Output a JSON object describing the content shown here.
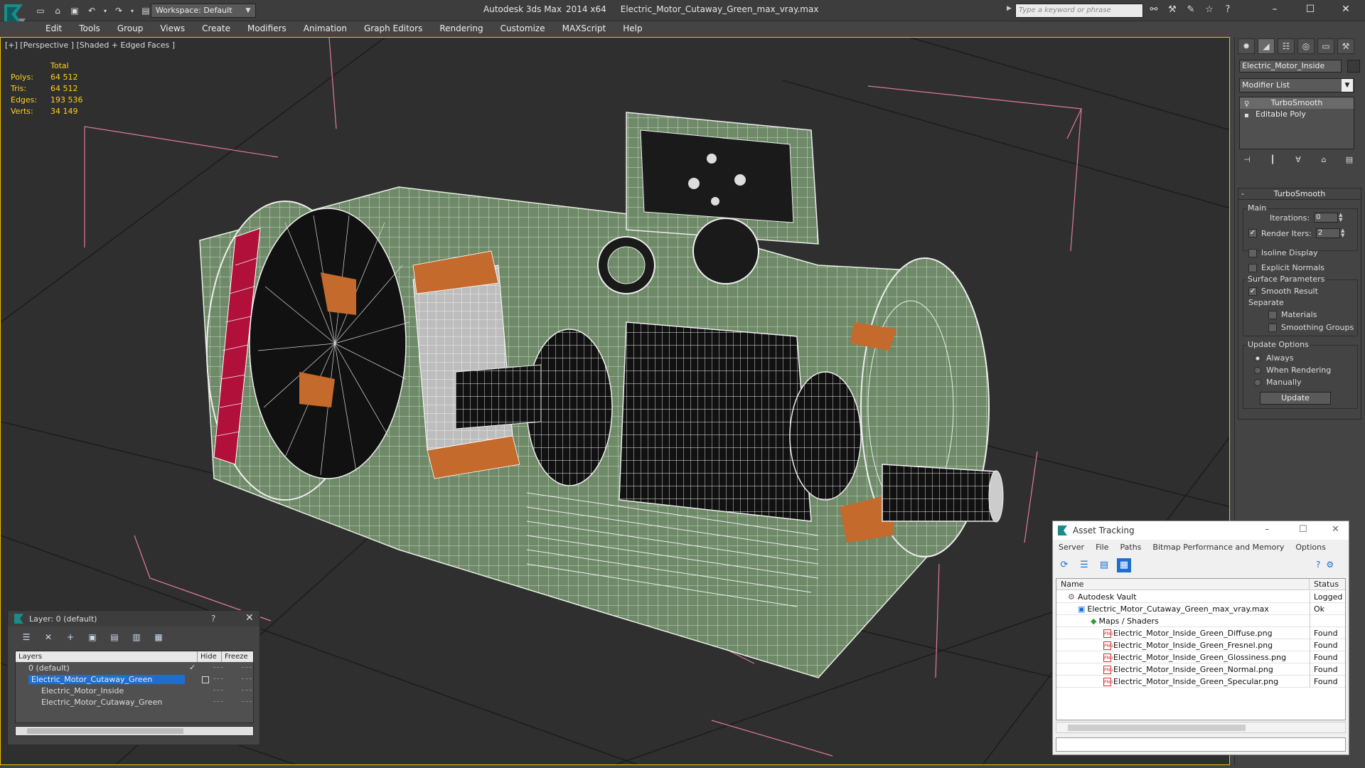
{
  "titlebar": {
    "app_name": "Autodesk 3ds Max",
    "version": "2014 x64",
    "file_name": "Electric_Motor_Cutaway_Green_max_vray.max",
    "workspace": "Workspace: Default",
    "search_placeholder": "Type a keyword or phrase",
    "minimize": "–",
    "maximize": "☐",
    "close": "✕"
  },
  "menu": [
    "Edit",
    "Tools",
    "Group",
    "Views",
    "Create",
    "Modifiers",
    "Animation",
    "Graph Editors",
    "Rendering",
    "Customize",
    "MAXScript",
    "Help"
  ],
  "viewport": {
    "label": "[+] [Perspective ] [Shaded + Edged Faces ]",
    "stats": {
      "header": "Total",
      "rows": [
        {
          "k": "Polys:",
          "v": "64 512"
        },
        {
          "k": "Tris:",
          "v": "64 512"
        },
        {
          "k": "Edges:",
          "v": "193 536"
        },
        {
          "k": "Verts:",
          "v": "34 149"
        }
      ]
    }
  },
  "command_panel": {
    "object_name": "Electric_Motor_Inside",
    "modifier_list": "Modifier List",
    "stack": [
      "TurboSmooth",
      "Editable Poly"
    ],
    "rollout_title": "TurboSmooth",
    "main_label": "Main",
    "iterations_label": "Iterations:",
    "iterations_value": "0",
    "render_iters_label": "Render Iters:",
    "render_iters_value": "2",
    "isoline_label": "Isoline Display",
    "explicit_label": "Explicit Normals",
    "surface_label": "Surface Parameters",
    "smooth_result_label": "Smooth Result",
    "separate_label": "Separate",
    "materials_label": "Materials",
    "smoothing_groups_label": "Smoothing Groups",
    "update_options_label": "Update Options",
    "always_label": "Always",
    "when_rendering_label": "When Rendering",
    "manually_label": "Manually",
    "update_button": "Update"
  },
  "layer_dialog": {
    "title": "Layer: 0 (default)",
    "help": "?",
    "close": "✕",
    "col_layers": "Layers",
    "col_hide": "Hide",
    "col_freeze": "Freeze",
    "rows": [
      {
        "name": "0 (default)"
      },
      {
        "name": "Electric_Motor_Cutaway_Green"
      },
      {
        "name": "Electric_Motor_Inside"
      },
      {
        "name": "Electric_Motor_Cutaway_Green"
      }
    ]
  },
  "asset_tracking": {
    "title": "Asset Tracking",
    "menu": [
      "Server",
      "File",
      "Paths",
      "Bitmap Performance and Memory",
      "Options"
    ],
    "col_name": "Name",
    "col_status": "Status",
    "rows": [
      {
        "name": "Autodesk Vault",
        "status": "Logged O"
      },
      {
        "name": "Electric_Motor_Cutaway_Green_max_vray.max",
        "status": "Ok"
      },
      {
        "name": "Maps / Shaders",
        "status": ""
      },
      {
        "name": "Electric_Motor_Inside_Green_Diffuse.png",
        "status": "Found"
      },
      {
        "name": "Electric_Motor_Inside_Green_Fresnel.png",
        "status": "Found"
      },
      {
        "name": "Electric_Motor_Inside_Green_Glossiness.png",
        "status": "Found"
      },
      {
        "name": "Electric_Motor_Inside_Green_Normal.png",
        "status": "Found"
      },
      {
        "name": "Electric_Motor_Inside_Green_Specular.png",
        "status": "Found"
      }
    ]
  },
  "colors": {
    "selection_yellow": "#f2c100",
    "motor_green": "#6f8a68",
    "copper": "#c46a2c",
    "red_band": "#b0103a",
    "accent_blue": "#1c6fd1"
  }
}
